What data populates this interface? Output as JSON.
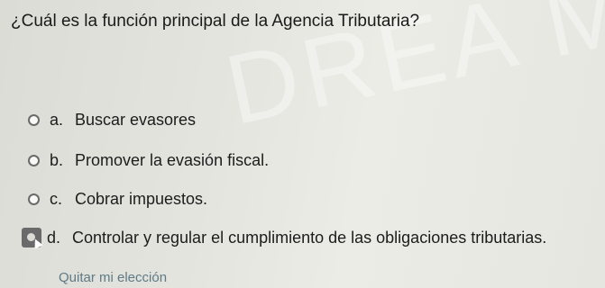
{
  "question": "¿Cuál es la función principal de la Agencia Tributaria?",
  "watermark": "DREA ME",
  "options": [
    {
      "letter": "a.",
      "text": "Buscar evasores"
    },
    {
      "letter": "b.",
      "text": "Promover la evasión fiscal."
    },
    {
      "letter": "c.",
      "text": "Cobrar impuestos."
    },
    {
      "letter": "d.",
      "text": "Controlar y regular el cumplimiento de las obligaciones tributarias."
    }
  ],
  "clear_choice": "Quitar mi elección",
  "colors": {
    "link": "#5e7a86",
    "text": "#1c1c1c"
  },
  "icons": {
    "radio": "radio-button-icon",
    "cursor": "mouse-pointer-icon"
  }
}
